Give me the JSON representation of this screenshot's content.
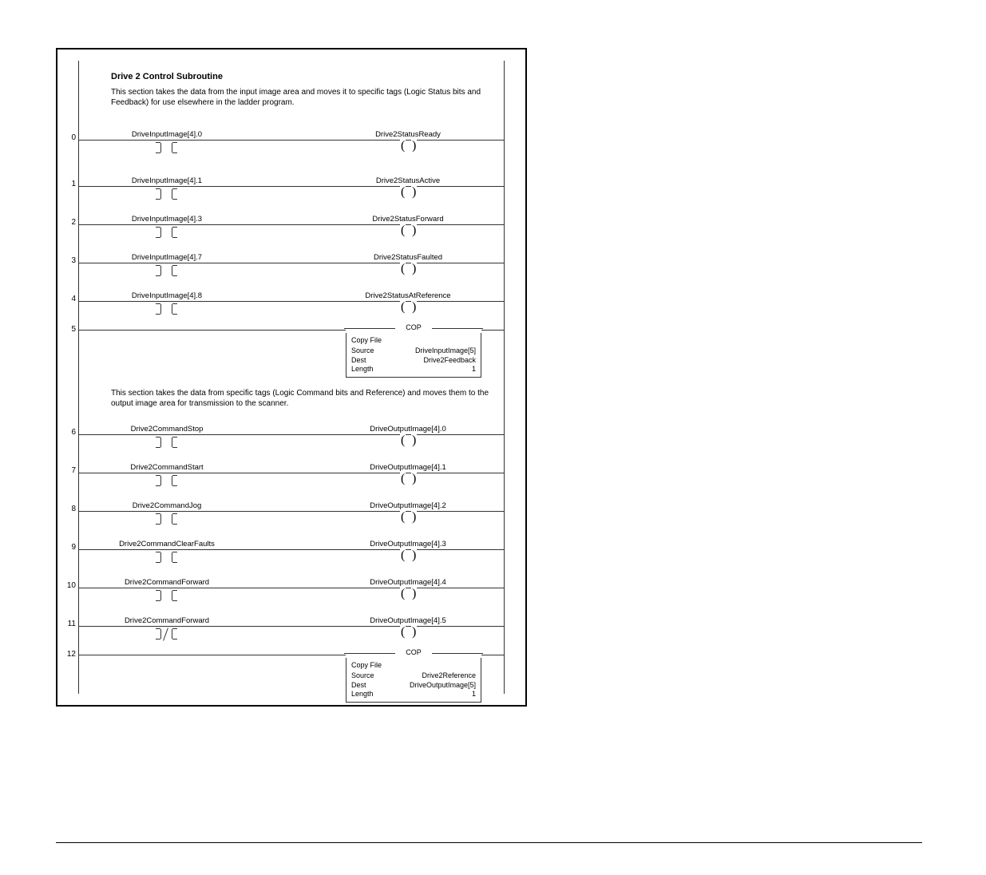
{
  "header": {
    "title": "Drive 2 Control Subroutine",
    "section1_desc": "This section takes the data from the input image area and moves it to specific tags (Logic Status bits and Feedback) for use elsewhere in the ladder program.",
    "section2_desc": "This section takes the data from specific tags (Logic Command bits and Reference) and moves them to the output image area for transmission to the scanner."
  },
  "rungs": [
    {
      "n": "0",
      "in": "DriveInputImage[4].0",
      "out": "Drive2StatusReady",
      "type": "xic-ote"
    },
    {
      "n": "1",
      "in": "DriveInputImage[4].1",
      "out": "Drive2StatusActive",
      "type": "xic-ote"
    },
    {
      "n": "2",
      "in": "DriveInputImage[4].3",
      "out": "Drive2StatusForward",
      "type": "xic-ote"
    },
    {
      "n": "3",
      "in": "DriveInputImage[4].7",
      "out": "Drive2StatusFaulted",
      "type": "xic-ote"
    },
    {
      "n": "4",
      "in": "DriveInputImage[4].8",
      "out": "Drive2StatusAtReference",
      "type": "xic-ote"
    },
    {
      "n": "5",
      "type": "cop",
      "cop": {
        "head": "COP",
        "title": "Copy File",
        "rows": [
          {
            "l": "Source",
            "r": "DriveInputImage[5]"
          },
          {
            "l": "Dest",
            "r": "Drive2Feedback"
          },
          {
            "l": "Length",
            "r": "1"
          }
        ]
      }
    },
    {
      "n": "6",
      "in": "Drive2CommandStop",
      "out": "DriveOutputImage[4].0",
      "type": "xic-ote"
    },
    {
      "n": "7",
      "in": "Drive2CommandStart",
      "out": "DriveOutputImage[4].1",
      "type": "xic-ote"
    },
    {
      "n": "8",
      "in": "Drive2CommandJog",
      "out": "DriveOutputImage[4].2",
      "type": "xic-ote"
    },
    {
      "n": "9",
      "in": "Drive2CommandClearFaults",
      "out": "DriveOutputImage[4].3",
      "type": "xic-ote"
    },
    {
      "n": "10",
      "in": "Drive2CommandForward",
      "out": "DriveOutputImage[4].4",
      "type": "xic-ote"
    },
    {
      "n": "11",
      "in": "Drive2CommandForward",
      "out": "DriveOutputImage[4].5",
      "type": "xio-ote"
    },
    {
      "n": "12",
      "type": "cop",
      "cop": {
        "head": "COP",
        "title": "Copy File",
        "rows": [
          {
            "l": "Source",
            "r": "Drive2Reference"
          },
          {
            "l": "Dest",
            "r": "DriveOutputImage[5]"
          },
          {
            "l": "Length",
            "r": "1"
          }
        ]
      }
    }
  ]
}
